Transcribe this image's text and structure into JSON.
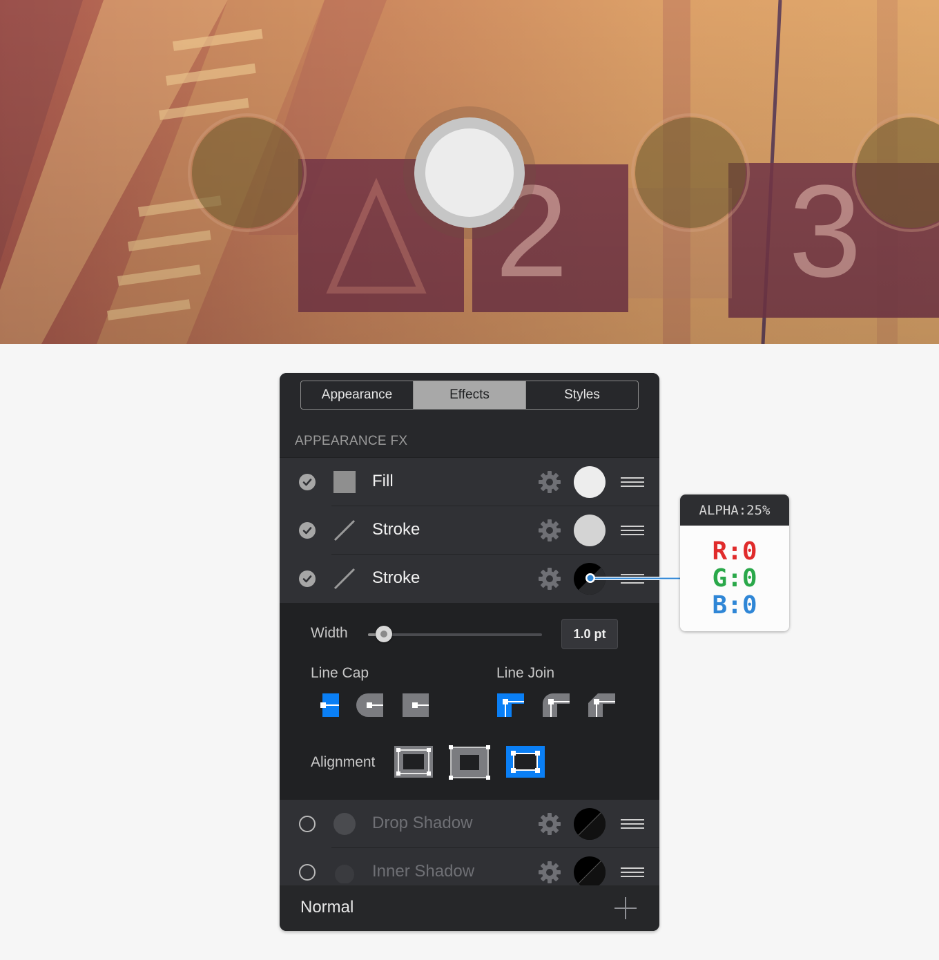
{
  "hero": {
    "signs": [
      "2",
      "3"
    ],
    "picker_dots": [
      {
        "state": "outline"
      },
      {
        "state": "selected"
      },
      {
        "state": "outline"
      },
      {
        "state": "outline"
      }
    ]
  },
  "panel": {
    "tabs": [
      {
        "label": "Appearance",
        "active": false
      },
      {
        "label": "Effects",
        "active": true
      },
      {
        "label": "Styles",
        "active": false
      }
    ],
    "section_title": "APPEARANCE FX",
    "layers": [
      {
        "label": "Fill",
        "enabled": true,
        "kind": "fill",
        "swatch": "#ededed",
        "thumb_icon": "square-icon"
      },
      {
        "label": "Stroke",
        "enabled": true,
        "kind": "stroke",
        "swatch": "#d4d4d4",
        "thumb_icon": "line-icon"
      },
      {
        "label": "Stroke",
        "enabled": true,
        "kind": "stroke",
        "swatch": "#000000",
        "thumb_icon": "line-icon"
      }
    ],
    "stroke_options": {
      "width_label": "Width",
      "width_value": "1.0 pt",
      "width_fraction": 0.05,
      "line_cap_label": "Line Cap",
      "line_cap_selected": 0,
      "line_join_label": "Line Join",
      "line_join_selected": 0,
      "alignment_label": "Alignment",
      "alignment_selected": 2
    },
    "effects": [
      {
        "label": "Drop Shadow",
        "enabled": false
      },
      {
        "label": "Inner Shadow",
        "enabled": false
      }
    ],
    "blend_mode": "Normal"
  },
  "color_tooltip": {
    "alpha": "ALPHA:25%",
    "r": "R:0",
    "g": "G:0",
    "b": "B:0"
  },
  "colors": {
    "accent_blue": "#0a7ff5",
    "red": "#e02b2b",
    "green": "#2aa84a",
    "blue": "#2f86d6"
  }
}
